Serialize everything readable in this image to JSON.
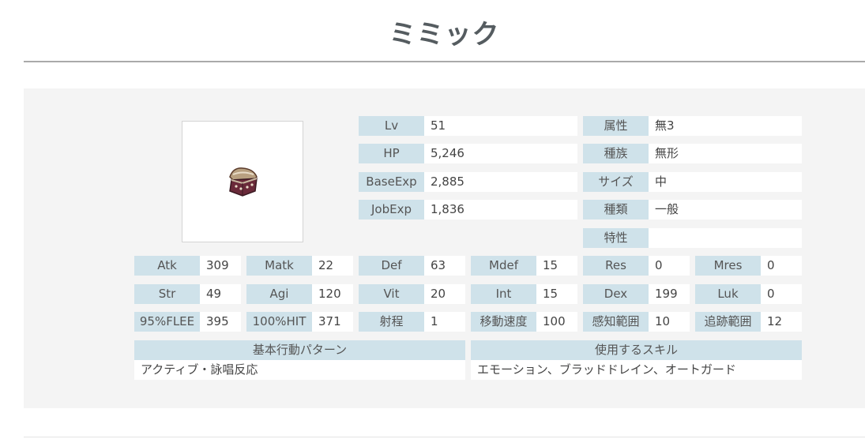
{
  "monster": {
    "name": "ミミック"
  },
  "info_left": [
    {
      "label": "Lv",
      "value": "51"
    },
    {
      "label": "HP",
      "value": "5,246"
    },
    {
      "label": "BaseExp",
      "value": "2,885"
    },
    {
      "label": "JobExp",
      "value": "1,836"
    }
  ],
  "info_right": [
    {
      "label": "属性",
      "value": "無3"
    },
    {
      "label": "種族",
      "value": "無形"
    },
    {
      "label": "サイズ",
      "value": "中"
    },
    {
      "label": "種類",
      "value": "一般"
    },
    {
      "label": "特性",
      "value": ""
    }
  ],
  "stats": [
    [
      {
        "label": "Atk",
        "value": "309"
      },
      {
        "label": "Matk",
        "value": "22"
      },
      {
        "label": "Def",
        "value": "63"
      },
      {
        "label": "Mdef",
        "value": "15"
      },
      {
        "label": "Res",
        "value": "0"
      },
      {
        "label": "Mres",
        "value": "0"
      }
    ],
    [
      {
        "label": "Str",
        "value": "49"
      },
      {
        "label": "Agi",
        "value": "120"
      },
      {
        "label": "Vit",
        "value": "20"
      },
      {
        "label": "Int",
        "value": "15"
      },
      {
        "label": "Dex",
        "value": "199"
      },
      {
        "label": "Luk",
        "value": "0"
      }
    ],
    [
      {
        "label": "95%FLEE",
        "value": "395"
      },
      {
        "label": "100%HIT",
        "value": "371"
      },
      {
        "label": "射程",
        "value": "1"
      },
      {
        "label": "移動速度",
        "value": "100"
      },
      {
        "label": "感知範囲",
        "value": "10"
      },
      {
        "label": "追跡範囲",
        "value": "12"
      }
    ]
  ],
  "behavior": {
    "header": "基本行動パターン",
    "value": "アクティブ・詠唱反応"
  },
  "skills": {
    "header": "使用するスキル",
    "value": "エモーション、ブラッドドレイン、オートガード"
  },
  "icons": {
    "portrait": "mimic-chest-icon"
  }
}
